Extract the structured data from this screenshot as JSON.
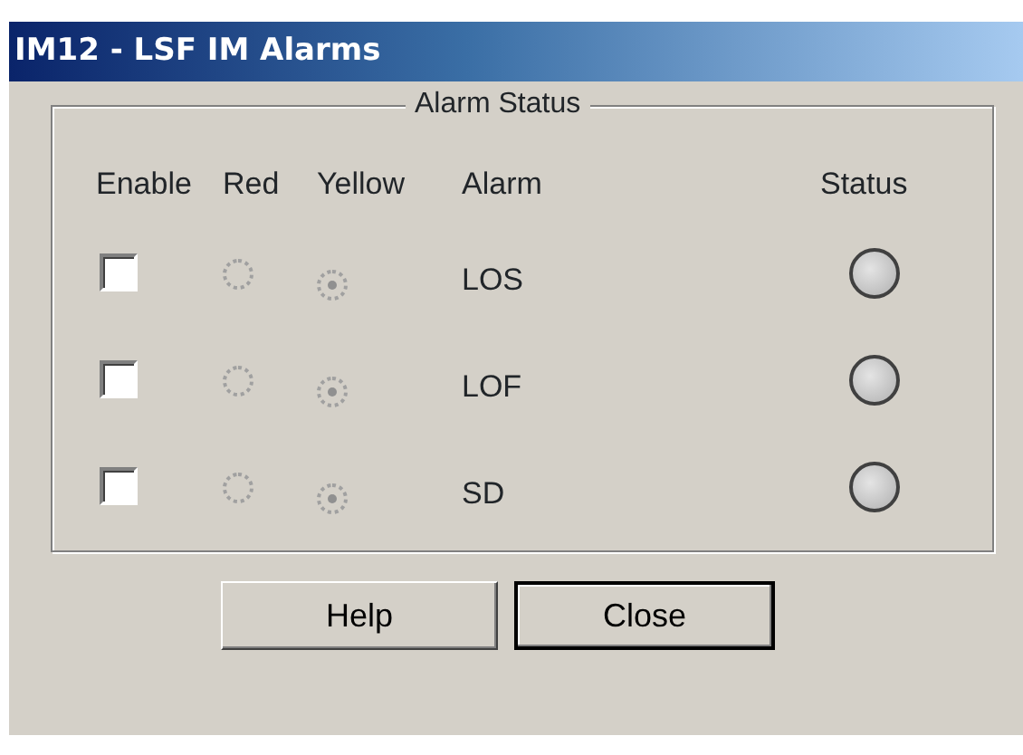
{
  "window": {
    "title": "IM12 - LSF IM Alarms"
  },
  "group": {
    "title": "Alarm Status"
  },
  "columns": [
    "Enable",
    "Red",
    "Yellow",
    "Alarm",
    "Status"
  ],
  "alarms": [
    {
      "name": "LOS",
      "enabled": false,
      "red_selected": false,
      "yellow_selected": true,
      "radios_disabled": true
    },
    {
      "name": "LOF",
      "enabled": false,
      "red_selected": false,
      "yellow_selected": true,
      "radios_disabled": true
    },
    {
      "name": "SD",
      "enabled": false,
      "red_selected": false,
      "yellow_selected": true,
      "radios_disabled": true
    }
  ],
  "buttons": [
    {
      "label": "Help",
      "focused": false
    },
    {
      "label": "Close",
      "focused": true
    }
  ]
}
